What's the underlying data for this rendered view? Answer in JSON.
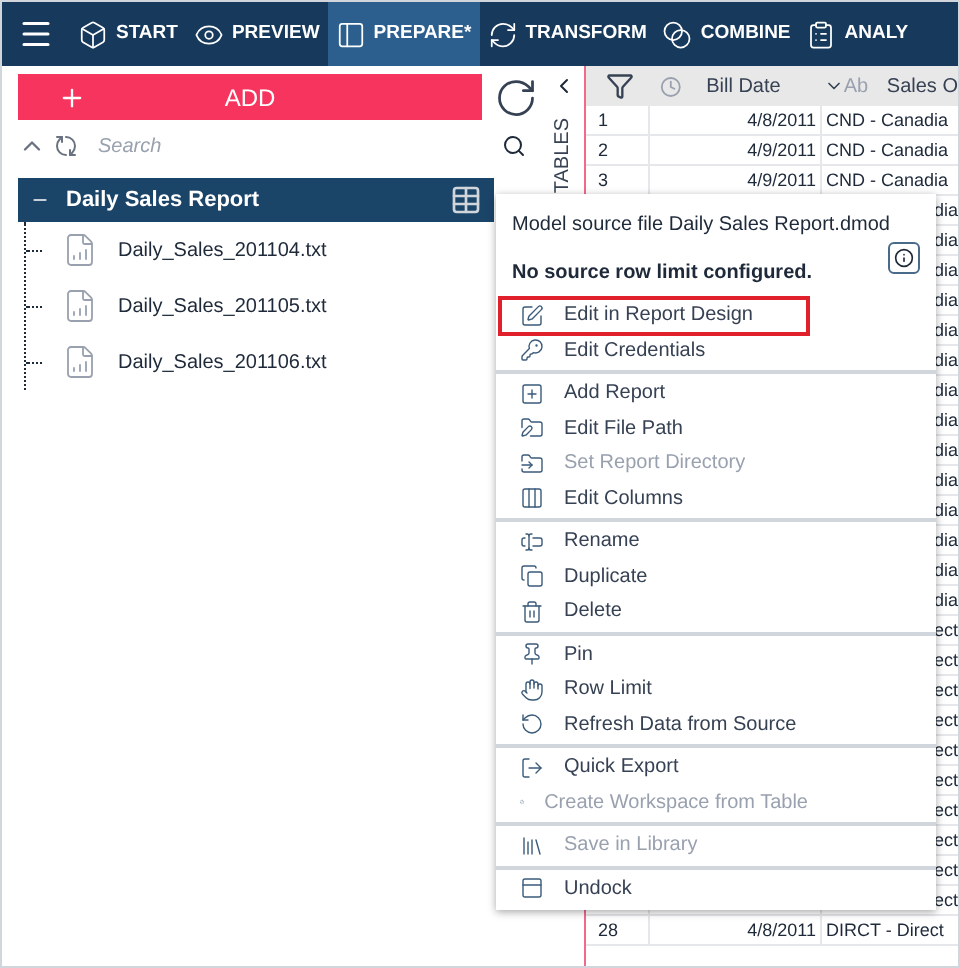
{
  "nav": {
    "tabs": [
      {
        "label": "START",
        "selected": false
      },
      {
        "label": "PREVIEW",
        "selected": false
      },
      {
        "label": "PREPARE*",
        "selected": true
      },
      {
        "label": "TRANSFORM",
        "selected": false
      },
      {
        "label": "COMBINE",
        "selected": false
      },
      {
        "label": "ANALY",
        "selected": false
      }
    ]
  },
  "left_panel": {
    "add_button": "ADD",
    "search": {
      "placeholder": "Search"
    },
    "tables_label": "TABLES",
    "tree": {
      "label": "Daily Sales Report",
      "expanded": true,
      "children": [
        {
          "label": "Daily_Sales_201104.txt"
        },
        {
          "label": "Daily_Sales_201105.txt"
        },
        {
          "label": "Daily_Sales_201106.txt"
        }
      ]
    }
  },
  "table": {
    "columns": [
      "Bill Date",
      "Ab",
      "Sales O"
    ],
    "rows": [
      {
        "number": "1",
        "bill_date": "4/8/2011",
        "sales": "CND - Canadia"
      },
      {
        "number": "2",
        "bill_date": "4/9/2011",
        "sales": "CND - Canadia"
      },
      {
        "number": "3",
        "bill_date": "4/9/2011",
        "sales": "CND - Canadia"
      },
      {
        "sales": "dia"
      },
      {
        "sales": "dia"
      },
      {
        "sales": "dia"
      },
      {
        "sales": "dia"
      },
      {
        "sales": "dia"
      },
      {
        "sales": "dia"
      },
      {
        "sales": "dia"
      },
      {
        "sales": "dia"
      },
      {
        "sales": "dia"
      },
      {
        "sales": "dia"
      },
      {
        "sales": "dia"
      },
      {
        "sales": "dia"
      },
      {
        "sales": "dia"
      },
      {
        "sales": "dia"
      },
      {
        "sales": "ect"
      },
      {
        "sales": "ect"
      },
      {
        "sales": "ect"
      },
      {
        "sales": "ect"
      },
      {
        "sales": "ect"
      },
      {
        "sales": "ect"
      },
      {
        "sales": "ect"
      },
      {
        "sales": "ect"
      },
      {
        "sales": "ect"
      },
      {
        "sales": "ect"
      },
      {
        "number": "28",
        "bill_date": "4/8/2011",
        "sales": "DIRCT - Direct"
      }
    ]
  },
  "context_menu": {
    "info_lines": [
      "Model source file Daily Sales Report.dmod",
      "No source row limit configured."
    ],
    "sections": [
      [
        {
          "label": "Edit in Report Design",
          "outlined": true,
          "disabled": false
        },
        {
          "label": "Edit Credentials",
          "outlined": false,
          "disabled": false
        }
      ],
      [
        {
          "label": "Add Report",
          "outlined": false,
          "disabled": false
        },
        {
          "label": "Edit File Path",
          "outlined": false,
          "disabled": false
        },
        {
          "label": "Set Report Directory",
          "outlined": false,
          "disabled": true
        },
        {
          "label": "Edit Columns",
          "outlined": false,
          "disabled": false
        }
      ],
      [
        {
          "label": "Rename",
          "outlined": false,
          "disabled": false
        },
        {
          "label": "Duplicate",
          "outlined": false,
          "disabled": false
        },
        {
          "label": "Delete",
          "outlined": false,
          "disabled": false
        }
      ],
      [
        {
          "label": "Pin",
          "outlined": false,
          "disabled": false
        },
        {
          "label": "Row Limit",
          "outlined": false,
          "disabled": false
        },
        {
          "label": "Refresh Data from Source",
          "outlined": false,
          "disabled": false
        }
      ],
      [
        {
          "label": "Quick Export",
          "outlined": false,
          "disabled": false
        },
        {
          "label": "Create Workspace from Table",
          "outlined": false,
          "disabled": true
        }
      ],
      [
        {
          "label": "Save in Library",
          "outlined": false,
          "disabled": true
        }
      ],
      [
        {
          "label": "Undock",
          "outlined": false,
          "disabled": false
        }
      ]
    ]
  }
}
